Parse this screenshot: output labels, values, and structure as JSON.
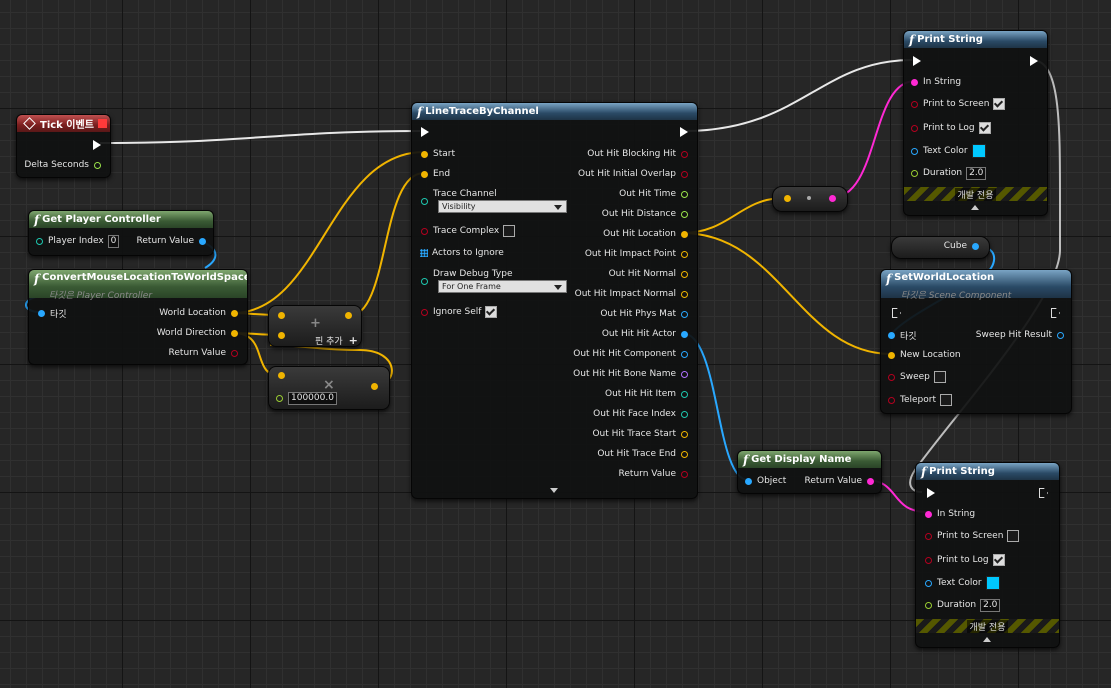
{
  "tick": {
    "title": "Tick 이벤트",
    "delta": "Delta Seconds"
  },
  "gpc": {
    "title": "Get Player Controller",
    "player_index": "Player Index",
    "player_index_value": "0",
    "return_value": "Return Value"
  },
  "cmw": {
    "title": "ConvertMouseLocationToWorldSpace",
    "subtitle": "타깃은 Player Controller",
    "target": "타깃",
    "world_location": "World Location",
    "world_direction": "World Direction",
    "return_value": "Return Value"
  },
  "add": {
    "symbol": "+",
    "add_pin": "핀 추가"
  },
  "mul": {
    "symbol": "×",
    "value": "100000.0"
  },
  "ltc": {
    "title": "LineTraceByChannel",
    "start": "Start",
    "end": "End",
    "trace_channel": "Trace Channel",
    "trace_channel_value": "Visibility",
    "trace_complex": "Trace Complex",
    "actors_to_ignore": "Actors to Ignore",
    "draw_debug_type": "Draw Debug Type",
    "draw_debug_value": "For One Frame",
    "ignore_self": "Ignore Self",
    "outputs": [
      "Out Hit Blocking Hit",
      "Out Hit Initial Overlap",
      "Out Hit Time",
      "Out Hit Distance",
      "Out Hit Location",
      "Out Hit Impact Point",
      "Out Hit Normal",
      "Out Hit Impact Normal",
      "Out Hit Phys Mat",
      "Out Hit Hit Actor",
      "Out Hit Hit Component",
      "Out Hit Hit Bone Name",
      "Out Hit Hit Item",
      "Out Hit Face Index",
      "Out Hit Trace Start",
      "Out Hit Trace End",
      "Return Value"
    ]
  },
  "ps1": {
    "title": "Print String",
    "in_string": "In String",
    "print_to_screen": "Print to Screen",
    "print_to_log": "Print to Log",
    "text_color": "Text Color",
    "duration": "Duration",
    "duration_value": "2.0",
    "dev_only": "개발 전용"
  },
  "cube": {
    "label": "Cube"
  },
  "swl": {
    "title": "SetWorldLocation",
    "subtitle": "타깃은 Scene Component",
    "target": "타깃",
    "sweep_hit_result": "Sweep Hit Result",
    "new_location": "New Location",
    "sweep": "Sweep",
    "teleport": "Teleport"
  },
  "gdn": {
    "title": "Get Display Name",
    "object": "Object",
    "return_value": "Return Value"
  },
  "ps2": {
    "title": "Print String",
    "in_string": "In String",
    "print_to_screen": "Print to Screen",
    "print_to_log": "Print to Log",
    "text_color": "Text Color",
    "duration": "Duration",
    "duration_value": "2.0",
    "dev_only": "개발 전용"
  },
  "colors": {
    "exec": "#ffffff",
    "vector": "#f0b400",
    "object": "#29a8ff",
    "string": "#ff29d4",
    "float": "#9ae34a",
    "bool": "#b3001f",
    "text_color": "#00c8ff"
  }
}
